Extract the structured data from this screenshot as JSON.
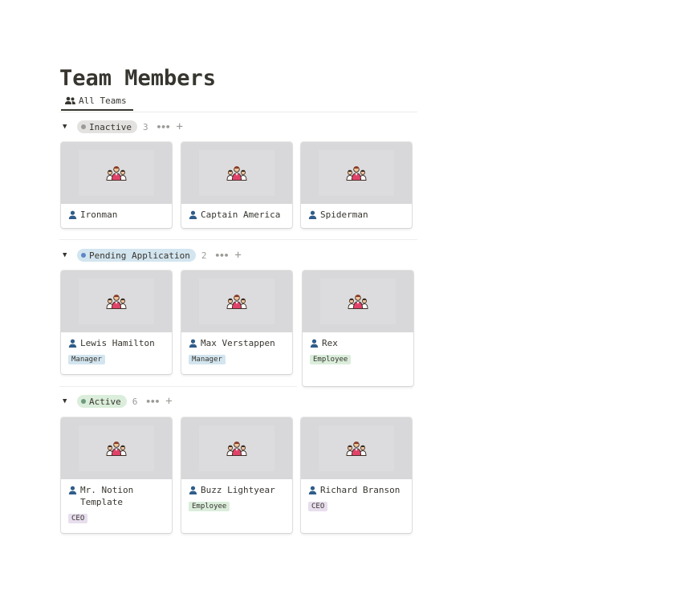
{
  "page": {
    "title": "Team Members"
  },
  "tabs": [
    {
      "label": "All Teams"
    }
  ],
  "colors": {
    "inactive_pill": "#e3e2e0",
    "inactive_dot": "#9b9a97",
    "pending_pill": "#d3e5ef",
    "pending_dot": "#5e87c9",
    "active_pill": "#dbeddb",
    "active_dot": "#6c9b7d",
    "manager_tag": "#d3e5ef",
    "employee_tag": "#dbeddb",
    "ceo_tag": "#e8deee"
  },
  "groups": [
    {
      "label": "Inactive",
      "count": "3",
      "cards": [
        {
          "name": "Ironman"
        },
        {
          "name": "Captain America"
        },
        {
          "name": "Spiderman"
        }
      ]
    },
    {
      "label": "Pending Application",
      "count": "2",
      "cards": [
        {
          "name": "Lewis Hamilton",
          "tag": "Manager"
        },
        {
          "name": "Max Verstappen",
          "tag": "Manager"
        },
        {
          "name": "Rex",
          "tag": "Employee"
        }
      ]
    },
    {
      "label": "Active",
      "count": "6",
      "cards": [
        {
          "name": "Mr. Notion Template",
          "tag": "CEO"
        },
        {
          "name": "Buzz Lightyear",
          "tag": "Employee"
        },
        {
          "name": "Richard Branson",
          "tag": "CEO"
        }
      ]
    }
  ],
  "icons": {
    "tab": "people-icon",
    "card_name": "person-icon",
    "cover": "team-people-icon"
  }
}
